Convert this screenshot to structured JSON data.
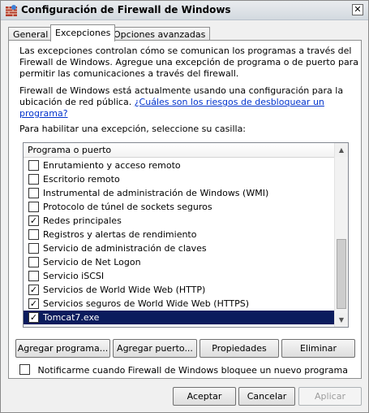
{
  "window": {
    "title": "Configuración de Firewall de Windows",
    "close_glyph": "✕"
  },
  "tabs": [
    {
      "label": "General",
      "active": false
    },
    {
      "label": "Excepciones",
      "active": true
    },
    {
      "label": "Opciones avanzadas",
      "active": false
    }
  ],
  "panel": {
    "intro": "Las excepciones controlan cómo se comunican los programas a través del Firewall de Windows. Agregue una excepción de programa o de puerto para permitir las comunicaciones a través del firewall.",
    "status_text": "Firewall de Windows está actualmente usando una configuración para la ubicación de red pública.",
    "status_link": "¿Cuáles son los riesgos de desbloquear un programa?",
    "instruction": "Para habilitar una excepción, seleccione su casilla:",
    "list_header": "Programa o puerto",
    "items": [
      {
        "label": "Enrutamiento y acceso remoto",
        "checked": false
      },
      {
        "label": "Escritorio remoto",
        "checked": false
      },
      {
        "label": "Instrumental de administración de Windows (WMI)",
        "checked": false
      },
      {
        "label": "Protocolo de túnel de sockets seguros",
        "checked": false
      },
      {
        "label": "Redes principales",
        "checked": true
      },
      {
        "label": "Registros y alertas de rendimiento",
        "checked": false
      },
      {
        "label": "Servicio de administración de claves",
        "checked": false
      },
      {
        "label": "Servicio de Net Logon",
        "checked": false
      },
      {
        "label": "Servicio iSCSI",
        "checked": false
      },
      {
        "label": "Servicios de World Wide Web (HTTP)",
        "checked": true
      },
      {
        "label": "Servicios seguros de World Wide Web (HTTPS)",
        "checked": true
      },
      {
        "label": "Tomcat7.exe",
        "checked": true,
        "selected": true
      }
    ],
    "buttons": {
      "add_program": "Agregar programa...",
      "add_port": "Agregar puerto...",
      "properties": "Propiedades",
      "delete": "Eliminar"
    },
    "notify_label": "Notificarme cuando Firewall de Windows bloquee un nuevo programa",
    "notify_checked": false
  },
  "footer": {
    "ok": "Aceptar",
    "cancel": "Cancelar",
    "apply": "Aplicar"
  },
  "colors": {
    "selection": "#0b1c5d",
    "link": "#0033cc"
  }
}
